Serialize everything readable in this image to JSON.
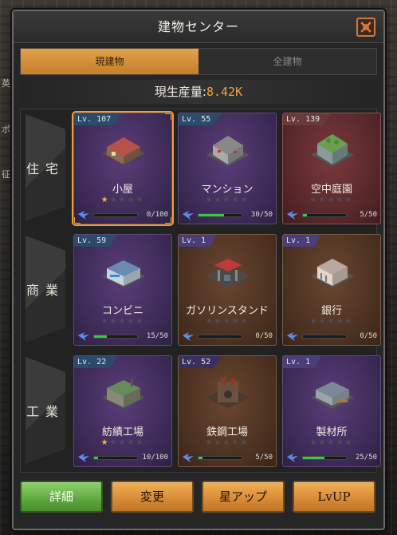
{
  "window": {
    "title": "建物センター"
  },
  "tabs": [
    {
      "label": "現建物",
      "active": true
    },
    {
      "label": "全建物",
      "active": false
    }
  ],
  "production": {
    "label": "現生産量:",
    "value": "8.42K"
  },
  "rows": [
    {
      "label": "住宅",
      "buildings": [
        {
          "level": "Lv. 107",
          "name": "小屋",
          "stars": 1,
          "progress": 0.0,
          "count": "0/100",
          "theme": "purple",
          "selected": true
        },
        {
          "level": "Lv. 55",
          "name": "マンション",
          "stars": 0,
          "progress": 0.6,
          "count": "30/50",
          "theme": "purple",
          "selected": false
        },
        {
          "level": "Lv. 139",
          "name": "空中庭園",
          "stars": 0,
          "progress": 0.1,
          "count": "5/50",
          "theme": "red",
          "selected": false
        }
      ]
    },
    {
      "label": "商業",
      "buildings": [
        {
          "level": "Lv. 59",
          "name": "コンビニ",
          "stars": 0,
          "progress": 0.3,
          "count": "15/50",
          "theme": "purple",
          "selected": false
        },
        {
          "level": "Lv. 1",
          "name": "ガソリンスタンド",
          "stars": 0,
          "progress": 0.0,
          "count": "0/50",
          "theme": "brown",
          "selected": false
        },
        {
          "level": "Lv. 1",
          "name": "銀行",
          "stars": 0,
          "progress": 0.0,
          "count": "0/50",
          "theme": "brown",
          "selected": false
        }
      ]
    },
    {
      "label": "工業",
      "buildings": [
        {
          "level": "Lv. 22",
          "name": "紡績工場",
          "stars": 1,
          "progress": 0.1,
          "count": "10/100",
          "theme": "purple",
          "selected": false
        },
        {
          "level": "Lv. 52",
          "name": "鉄鋼工場",
          "stars": 0,
          "progress": 0.1,
          "count": "5/50",
          "theme": "brown",
          "selected": false
        },
        {
          "level": "Lv. 1",
          "name": "製材所",
          "stars": 0,
          "progress": 0.5,
          "count": "25/50",
          "theme": "purple",
          "selected": false
        }
      ]
    }
  ],
  "actions": [
    {
      "label": "詳細",
      "style": "green"
    },
    {
      "label": "変更",
      "style": "orange"
    },
    {
      "label": "星アップ",
      "style": "orange"
    },
    {
      "label": "LvUP",
      "style": "orange"
    }
  ],
  "background_side_text": [
    "英",
    "ポ",
    "征"
  ],
  "colors": {
    "accent": "#f5a33b",
    "progress": "#37c84a",
    "star": "#f2b53a"
  }
}
